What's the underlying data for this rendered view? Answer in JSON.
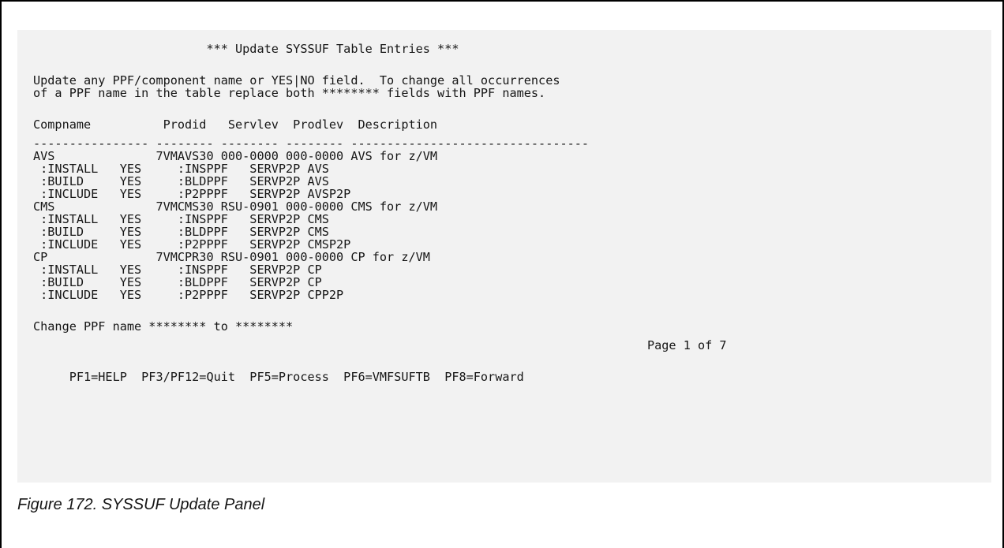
{
  "panel": {
    "title": "                        *** Update SYSSUF Table Entries ***",
    "instructions": [
      "Update any PPF/component name or YES|NO field.  To change all occurrences",
      "of a PPF name in the table replace both ******** fields with PPF names."
    ],
    "column_header": "Compname          Prodid   Servlev  Prodlev  Description",
    "column_rule": "---------------- -------- -------- -------- ---------------------------------",
    "rows": [
      "AVS              7VMAVS30 000-0000 000-0000 AVS for z/VM",
      " :INSTALL   YES     :INSPPF   SERVP2P AVS",
      " :BUILD     YES     :BLDPPF   SERVP2P AVS",
      " :INCLUDE   YES     :P2PPPF   SERVP2P AVSP2P",
      "CMS              7VMCMS30 RSU-0901 000-0000 CMS for z/VM",
      " :INSTALL   YES     :INSPPF   SERVP2P CMS",
      " :BUILD     YES     :BLDPPF   SERVP2P CMS",
      " :INCLUDE   YES     :P2PPPF   SERVP2P CMSP2P",
      "CP               7VMCPR30 RSU-0901 000-0000 CP for z/VM",
      " :INSTALL   YES     :INSPPF   SERVP2P CP",
      " :BUILD     YES     :BLDPPF   SERVP2P CP",
      " :INCLUDE   YES     :P2PPPF   SERVP2P CPP2P"
    ],
    "change_ppf": "Change PPF name ******** to ********",
    "page_indicator": "Page 1 of 7",
    "pf_keys": "     PF1=HELP  PF3/PF12=Quit  PF5=Process  PF6=VMFSUFTB  PF8=Forward"
  },
  "caption": "Figure 172. SYSSUF Update Panel"
}
